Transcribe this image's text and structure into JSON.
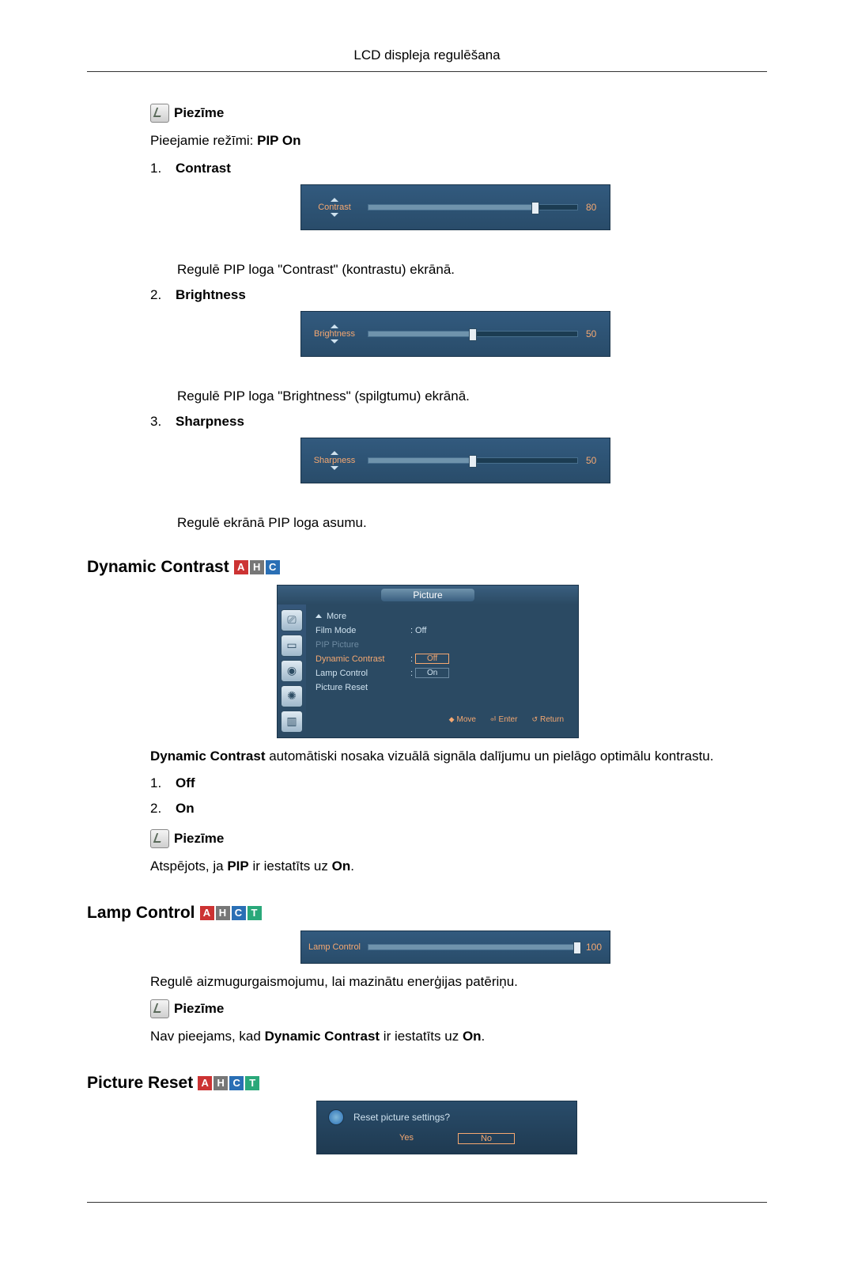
{
  "header": {
    "title": "LCD displeja regulēšana"
  },
  "note_label": "Piezīme",
  "available_modes": {
    "text": "Pieejamie režīmi: ",
    "mode": "PIP On"
  },
  "items": {
    "contrast": {
      "idx": "1.",
      "label": "Contrast",
      "slider_label": "Contrast",
      "value": "80",
      "desc": "Regulē PIP loga \"Contrast\" (kontrastu) ekrānā."
    },
    "brightness": {
      "idx": "2.",
      "label": "Brightness",
      "slider_label": "Brightness",
      "value": "50",
      "desc": "Regulē PIP loga \"Brightness\" (spilgtumu) ekrānā."
    },
    "sharpness": {
      "idx": "3.",
      "label": "Sharpness",
      "slider_label": "Sharpness",
      "value": "50",
      "desc": "Regulē ekrānā PIP loga asumu."
    }
  },
  "dc": {
    "heading": "Dynamic Contrast",
    "tags": [
      "A",
      "H",
      "C"
    ],
    "osd": {
      "tab": "Picture",
      "rows": {
        "more": "More",
        "film_mode": {
          "l": "Film Mode",
          "v": "Off"
        },
        "pip_picture": "PIP Picture",
        "dyn": {
          "l": "Dynamic Contrast",
          "v": "Off"
        },
        "lamp": {
          "l": "Lamp Control",
          "v": "On"
        },
        "reset": "Picture Reset"
      },
      "foot": {
        "move": "Move",
        "enter": "Enter",
        "ret": "Return"
      }
    },
    "para": {
      "lead": "Dynamic Contrast",
      "rest": " automātiski nosaka vizuālā signāla dalījumu un pielāgo optimālu kontrastu."
    },
    "opt1": {
      "idx": "1.",
      "label": "Off"
    },
    "opt2": {
      "idx": "2.",
      "label": "On"
    },
    "note_text": {
      "a": "Atspējots, ja ",
      "b": "PIP",
      "c": " ir iestatīts uz ",
      "d": "On",
      "e": "."
    }
  },
  "lamp": {
    "heading": "Lamp Control",
    "tags": [
      "A",
      "H",
      "C",
      "T"
    ],
    "slider_label": "Lamp Control",
    "value": "100",
    "desc": "Regulē aizmugurgaismojumu, lai mazinātu enerģijas patēriņu.",
    "note_text": {
      "a": "Nav pieejams, kad ",
      "b": "Dynamic Contrast",
      "c": " ir iestatīts uz ",
      "d": "On",
      "e": "."
    }
  },
  "preset": {
    "heading": "Picture Reset",
    "tags": [
      "A",
      "H",
      "C",
      "T"
    ],
    "dialog": {
      "q": "Reset picture settings?",
      "yes": "Yes",
      "no": "No"
    }
  },
  "chart_data": [
    {
      "type": "bar",
      "title": "Contrast slider",
      "categories": [
        "Contrast"
      ],
      "values": [
        80
      ],
      "ylim": [
        0,
        100
      ]
    },
    {
      "type": "bar",
      "title": "Brightness slider",
      "categories": [
        "Brightness"
      ],
      "values": [
        50
      ],
      "ylim": [
        0,
        100
      ]
    },
    {
      "type": "bar",
      "title": "Sharpness slider",
      "categories": [
        "Sharpness"
      ],
      "values": [
        50
      ],
      "ylim": [
        0,
        100
      ]
    },
    {
      "type": "bar",
      "title": "Lamp Control slider",
      "categories": [
        "Lamp Control"
      ],
      "values": [
        100
      ],
      "ylim": [
        0,
        100
      ]
    }
  ]
}
